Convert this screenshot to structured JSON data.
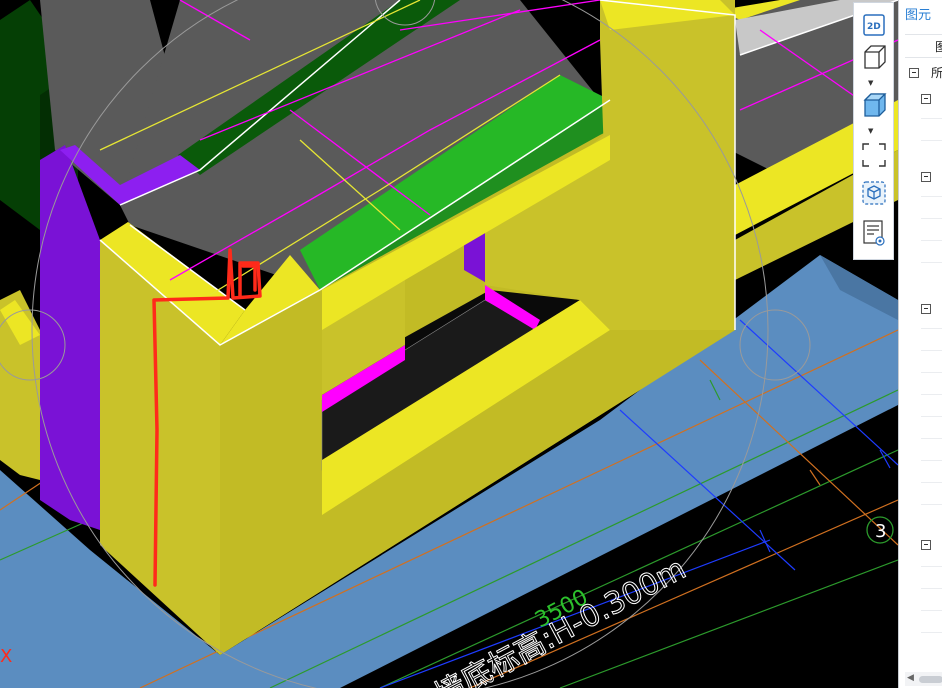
{
  "viewport": {
    "elevation_label": "墙底标高:H-0.300m",
    "dimension_label": "3500",
    "axis_label": "3",
    "x_axis_label": "X"
  },
  "toolbar": {
    "btn_2d_label": "2D",
    "icons": [
      "2d-view-icon",
      "3d-box-outline-icon",
      "3d-box-solid-icon",
      "select-region-icon",
      "component-view-icon",
      "display-settings-icon"
    ]
  },
  "panel": {
    "tab_label": "图元",
    "header_label": "图",
    "root_label": "所",
    "colors": {
      "tab_text": "#2a7fd4",
      "border": "#c8ccd2"
    }
  },
  "colors": {
    "wall_yellow": "#c9c22a",
    "wall_yellow_top": "#ece624",
    "purple": "#7a12d6",
    "magenta": "#ff00ff",
    "slab_grey": "#5a5a5a",
    "green": "#1f8f1f",
    "dark_green": "#053f05",
    "floor_blue": "#5b8dc0",
    "red_markup": "#ff2a1a"
  }
}
